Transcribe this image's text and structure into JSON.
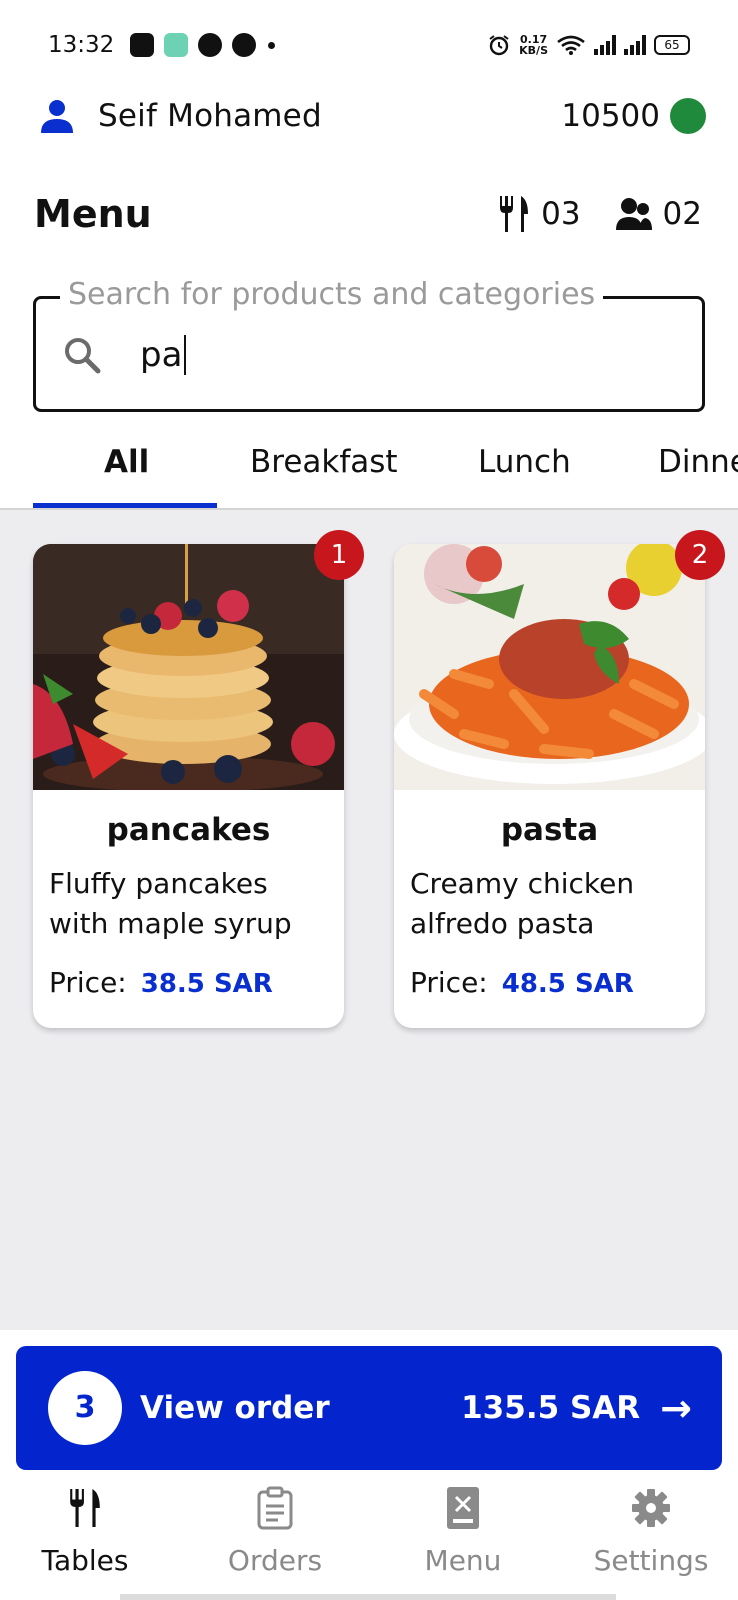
{
  "status_bar": {
    "time": "13:32",
    "net_speed_value": "0.17",
    "net_speed_unit": "KB/S",
    "battery": "65",
    "app_icons": [
      "teams-icon",
      "app-square-icon",
      "office365-icon",
      "app-circle-icon"
    ]
  },
  "user": {
    "name": "Seif Mohamed",
    "points": "10500",
    "status_color": "#1f8a3b"
  },
  "menu": {
    "title": "Menu",
    "tables_count": "03",
    "guests_count": "02"
  },
  "search": {
    "label": "Search for products and categories",
    "value": "pa"
  },
  "tabs": [
    {
      "label": "All",
      "active": true
    },
    {
      "label": "Breakfast",
      "active": false
    },
    {
      "label": "Lunch",
      "active": false
    },
    {
      "label": "Dinner",
      "active": false
    }
  ],
  "products": [
    {
      "badge": "1",
      "name": "pancakes",
      "description": "Fluffy pancakes with maple syrup",
      "price_label": "Price:",
      "price": "38.5 SAR"
    },
    {
      "badge": "2",
      "name": "pasta",
      "description": "Creamy chicken alfredo pasta",
      "price_label": "Price:",
      "price": "48.5 SAR"
    }
  ],
  "order": {
    "count": "3",
    "label": "View order",
    "total": "135.5 SAR"
  },
  "bottom_nav": [
    {
      "label": "Tables",
      "icon": "cutlery-icon",
      "active": true
    },
    {
      "label": "Orders",
      "icon": "clipboard-icon",
      "active": false
    },
    {
      "label": "Menu",
      "icon": "menu-book-icon",
      "active": false
    },
    {
      "label": "Settings",
      "icon": "gear-icon",
      "active": false
    }
  ],
  "colors": {
    "accent": "#0424cd",
    "badge": "#c8161d",
    "background": "#ededf0"
  }
}
